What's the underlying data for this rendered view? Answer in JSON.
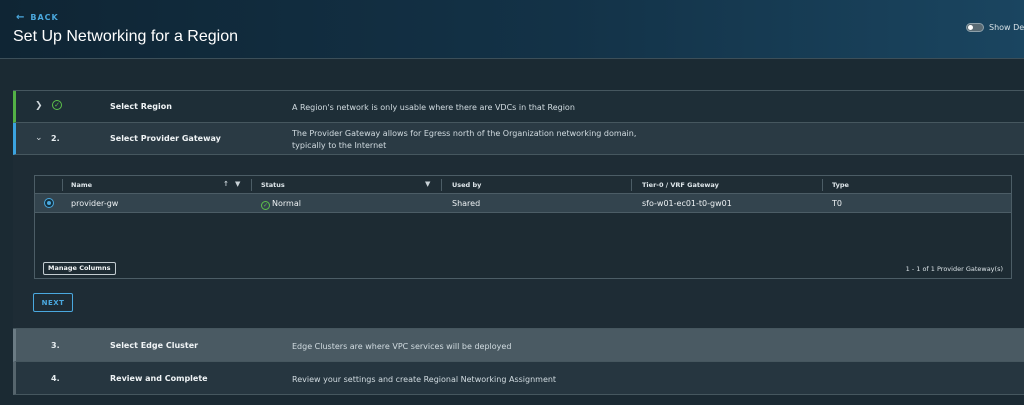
{
  "header": {
    "back_label": "BACK",
    "title": "Set Up Networking for a Region",
    "details_toggle_label": "Show Deta"
  },
  "wizard": {
    "steps": [
      {
        "number": "",
        "name": "Select Region",
        "description": "A Region's network is only usable where there are VDCs in that Region",
        "state": "completed"
      },
      {
        "number": "2.",
        "name": "Select Provider Gateway",
        "description": "The Provider Gateway allows for Egress north of the Organization networking domain, typically to the Internet",
        "state": "active"
      },
      {
        "number": "3.",
        "name": "Select Edge Cluster",
        "description": "Edge Clusters are where VPC services will be deployed",
        "state": "pending"
      },
      {
        "number": "4.",
        "name": "Review and Complete",
        "description": "Review your settings and create Regional Networking Assignment",
        "state": "pending"
      }
    ]
  },
  "grid": {
    "columns": [
      "Name",
      "Status",
      "Used by",
      "Tier-0 / VRF Gateway",
      "Type"
    ],
    "rows": [
      {
        "name": "provider-gw",
        "status": "Normal",
        "used_by": "Shared",
        "gateway": "sfo-w01-ec01-t0-gw01",
        "type": "T0"
      }
    ],
    "manage_columns_label": "Manage Columns",
    "pagination": "1 - 1 of 1 Provider Gateway(s)"
  },
  "next_label": "NEXT",
  "colors": {
    "accent": "#4aa8de",
    "success": "#5cc04a",
    "header_bg": "#133247"
  }
}
